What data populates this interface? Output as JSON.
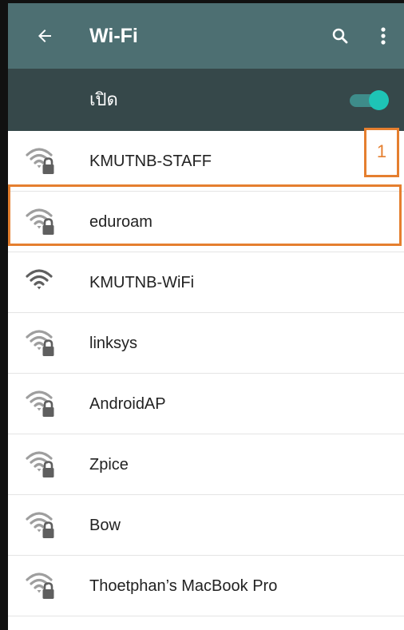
{
  "appbar": {
    "title": "Wi-Fi",
    "back_icon": "arrow-left-icon",
    "search_icon": "search-icon",
    "more_icon": "more-vert-icon",
    "background": "#4d6f72"
  },
  "toggle": {
    "label": "เปิด",
    "state": "on",
    "accent": "#1ec4b6",
    "background": "#36484a"
  },
  "networks": [
    {
      "name": "KMUTNB-STAFF",
      "secured": true,
      "signal": "strong"
    },
    {
      "name": "eduroam",
      "secured": true,
      "signal": "strong"
    },
    {
      "name": "KMUTNB-WiFi",
      "secured": false,
      "signal": "strong"
    },
    {
      "name": "linksys",
      "secured": true,
      "signal": "strong"
    },
    {
      "name": "AndroidAP",
      "secured": true,
      "signal": "strong"
    },
    {
      "name": "Zpice",
      "secured": true,
      "signal": "strong"
    },
    {
      "name": "Bow",
      "secured": true,
      "signal": "strong"
    },
    {
      "name": "Thoetphan’s MacBook Pro",
      "secured": true,
      "signal": "strong"
    }
  ],
  "annotation": {
    "callout_label": "1",
    "highlighted_network": "eduroam",
    "color": "#e57f2f"
  }
}
